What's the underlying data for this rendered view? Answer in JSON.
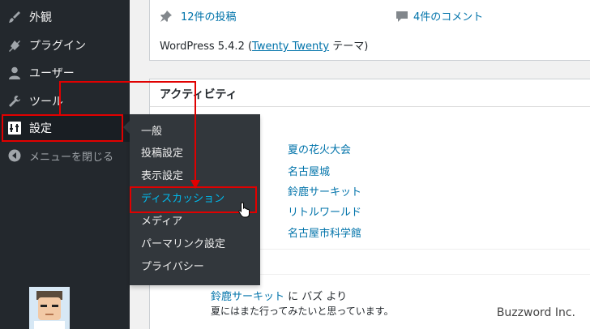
{
  "sidebar": {
    "items": [
      {
        "label": "外観",
        "icon": "paintbrush-icon"
      },
      {
        "label": "プラグイン",
        "icon": "plugin-icon"
      },
      {
        "label": "ユーザー",
        "icon": "user-icon"
      },
      {
        "label": "ツール",
        "icon": "wrench-icon"
      },
      {
        "label": "設定",
        "icon": "settings-sliders-icon"
      },
      {
        "label": "メニューを閉じる",
        "icon": "collapse-arrow-icon"
      }
    ]
  },
  "submenu": {
    "items": [
      "一般",
      "投稿設定",
      "表示設定",
      "ディスカッション",
      "メディア",
      "パーマリンク設定",
      "プライバシー"
    ],
    "highlighted": "ディスカッション"
  },
  "glance": {
    "posts": "12件の投稿",
    "comments": "4件のコメント",
    "version_prefix": "WordPress 5.4.2 (",
    "theme_link": "Twenty Twenty",
    "version_suffix": " テーマ)"
  },
  "activity": {
    "title": "アクティビティ",
    "posts": [
      "夏の花火大会",
      "名古屋城",
      "鈴鹿サーキット",
      "リトルワールド",
      "名古屋市科学館"
    ],
    "comment": {
      "post_link": "鈴鹿サーキット",
      "mid": " に ",
      "author": "バズ",
      "suffix": " より",
      "text": "夏にはまた行ってみたいと思っています。"
    }
  },
  "watermark": "Buzzword Inc.",
  "colors": {
    "sidebar_bg": "#23282d",
    "submenu_bg": "#32373c",
    "link": "#0073aa",
    "highlight": "#00b9eb",
    "annotation": "#e10000"
  }
}
